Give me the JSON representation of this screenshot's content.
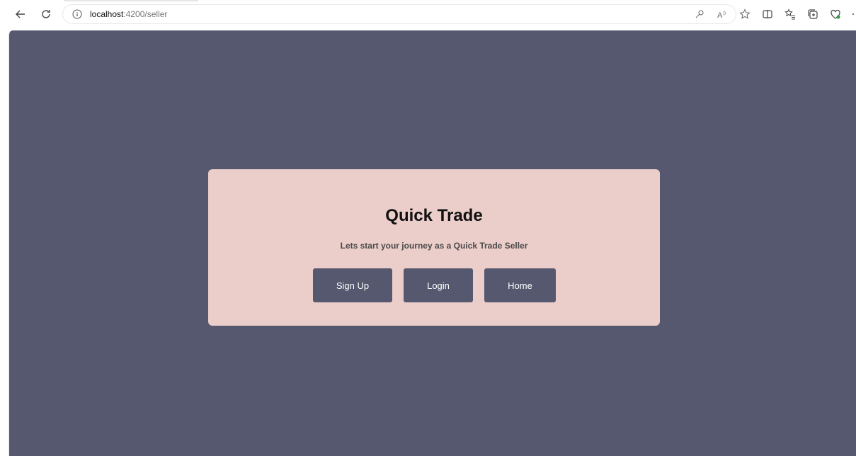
{
  "browser": {
    "url_host": "localhost",
    "url_path": ":4200/seller",
    "icons": [
      "back-arrow-icon",
      "reload-icon",
      "info-icon",
      "password-key-icon",
      "read-aloud-icon",
      "favorite-star-icon",
      "split-screen-icon",
      "favorites-list-icon",
      "collections-icon",
      "browser-essentials-icon",
      "more-icon"
    ]
  },
  "page": {
    "background_color": "#55586f",
    "card_color": "#ebcdca",
    "title": "Quick Trade",
    "subtitle": "Lets start your journey as a Quick Trade Seller",
    "buttons": {
      "signup": "Sign Up",
      "login": "Login",
      "home": "Home"
    }
  }
}
